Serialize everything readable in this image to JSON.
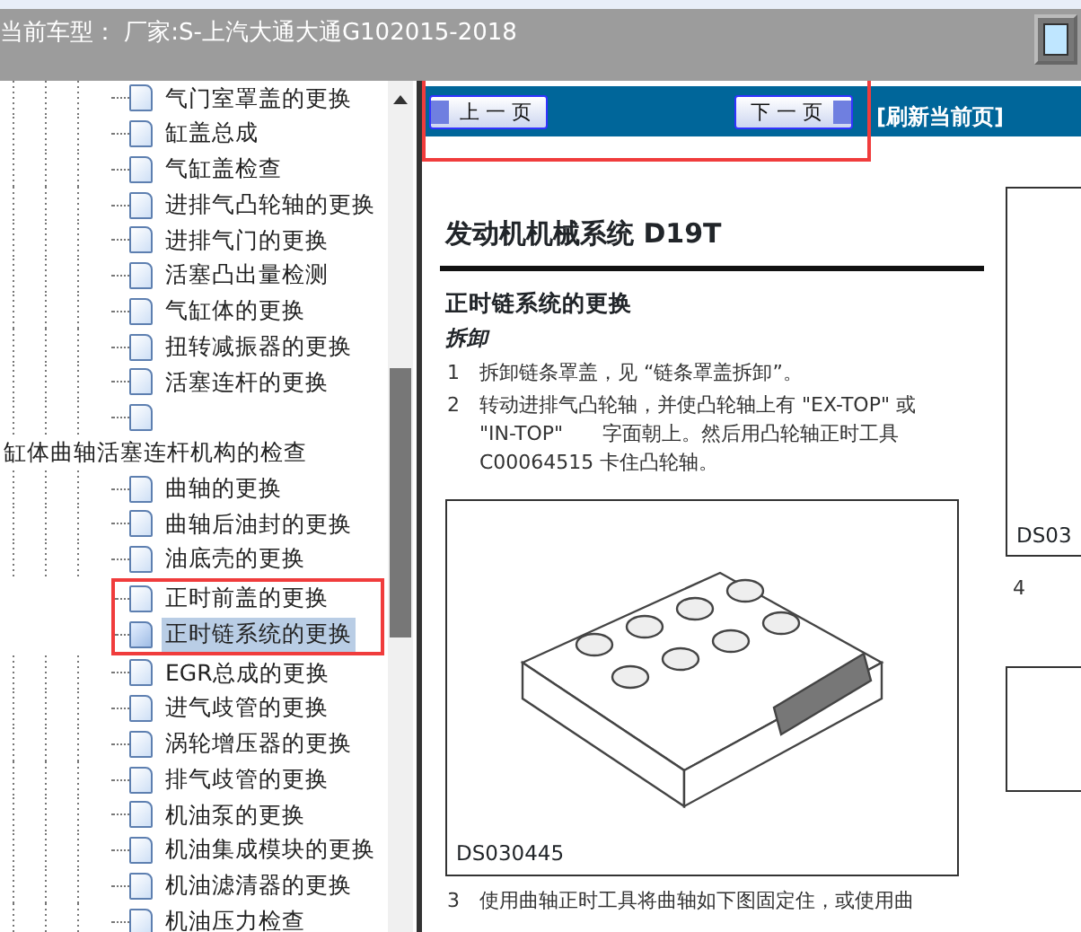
{
  "header": {
    "title": "当前车型：  厂家:S-上汽大通大通G102015-2018"
  },
  "tree": [
    {
      "children": [
        {
          "label": "气门室罩盖的更换",
          "selected": false,
          "marked": false
        },
        {
          "label": "缸盖总成",
          "selected": false,
          "marked": false
        },
        {
          "label": "气缸盖检查",
          "selected": false,
          "marked": false
        },
        {
          "label": "进排气凸轮轴的更换",
          "selected": false,
          "marked": false
        },
        {
          "label": "进排气门的更换",
          "selected": false,
          "marked": false
        },
        {
          "label": "活塞凸出量检测",
          "selected": false,
          "marked": false
        },
        {
          "label": "气缸体的更换",
          "selected": false,
          "marked": false
        },
        {
          "label": "扭转减振器的更换",
          "selected": false,
          "marked": false
        },
        {
          "label": "活塞连杆的更换",
          "selected": false,
          "marked": false
        },
        {
          "selected": false,
          "marked": false
        }
      ]
    },
    {
      "label": "缸体曲轴活塞连杆机构的检查",
      "children": [
        {
          "label": "曲轴的更换",
          "selected": false,
          "marked": false
        },
        {
          "label": "曲轴后油封的更换",
          "selected": false,
          "marked": false
        },
        {
          "label": "油底壳的更换",
          "selected": false,
          "marked": false
        },
        {
          "label": "正时前盖的更换",
          "selected": false,
          "marked": true
        },
        {
          "label": "正时链系统的更换",
          "selected": true,
          "marked": true
        },
        {
          "label": "EGR总成的更换",
          "selected": false,
          "marked": false
        },
        {
          "label": "进气歧管的更换",
          "selected": false,
          "marked": false
        },
        {
          "label": "涡轮增压器的更换",
          "selected": false,
          "marked": false
        },
        {
          "label": "排气歧管的更换",
          "selected": false,
          "marked": false
        },
        {
          "label": "机油泵的更换",
          "selected": false,
          "marked": false
        },
        {
          "label": "机油集成模块的更换",
          "selected": false,
          "marked": false
        },
        {
          "label": "机油滤清器的更换",
          "selected": false,
          "marked": false
        },
        {
          "label": "机油压力检查",
          "selected": false,
          "marked": false
        }
      ]
    }
  ],
  "nav": {
    "prev": "上 一 页",
    "next": "下 一 页",
    "refresh": "[刷新当前页]",
    "marked": true
  },
  "document": {
    "title": "发动机机械系统 D19T",
    "section": "正时链系统的更换",
    "subsection": "拆卸",
    "steps": [
      {
        "number": "1",
        "text": "拆卸链条罩盖，见 “链条罩盖拆卸”。"
      },
      {
        "number": "2",
        "text": "转动进排气凸轮轴，并使凸轮轴上有 \"EX-TOP\" 或 \"IN-TOP\"　　字面朝上。然后用凸轮轴正时工具 C00064515 卡住凸轮轴。"
      }
    ],
    "figure_caption": "DS030445",
    "after_steps": [
      {
        "number": "3",
        "text": "使用曲轴正时工具将曲轴如下图固定住，或使用曲"
      }
    ],
    "side_figure_caption": "DS03",
    "side_steps": [
      {
        "number": "4"
      }
    ]
  }
}
